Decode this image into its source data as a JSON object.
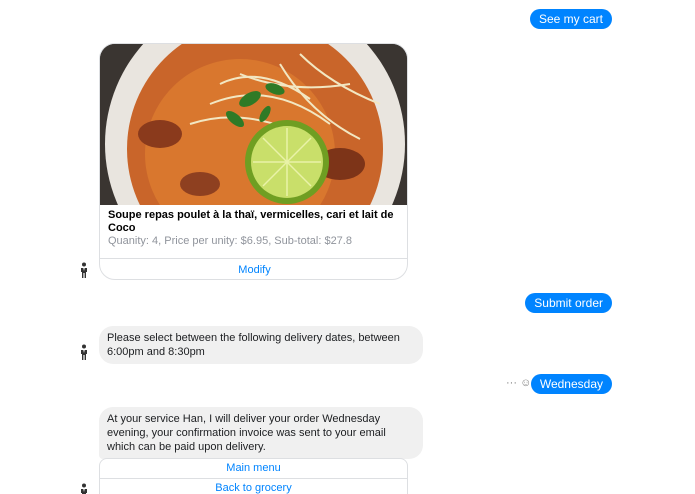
{
  "messages": {
    "see_cart": "See my cart",
    "submit_order": "Submit order",
    "wednesday": "Wednesday",
    "select_dates": "Please select between the following delivery dates, between 6:00pm and 8:30pm",
    "confirmation": "At your service Han, I will deliver your order Wednesday evening, your confirmation invoice was sent to your email which can be paid upon delivery."
  },
  "card": {
    "title": "Soupe repas poulet à la thaï, vermicelles, cari et lait de Coco",
    "subtitle": "Quanity: 4, Price per unity: $6.95, Sub-total: $27.8",
    "button": "Modify",
    "image_icon": "thai-soup-photo"
  },
  "quick_replies": {
    "main_menu": "Main menu",
    "back_to_grocery": "Back to grocery"
  },
  "message_actions": {
    "more": "···",
    "emoji": "☺"
  },
  "colors": {
    "accent": "#0084ff",
    "incoming_bubble": "#f0f0f0",
    "border": "#dddfe2",
    "muted_text": "#90949c"
  }
}
